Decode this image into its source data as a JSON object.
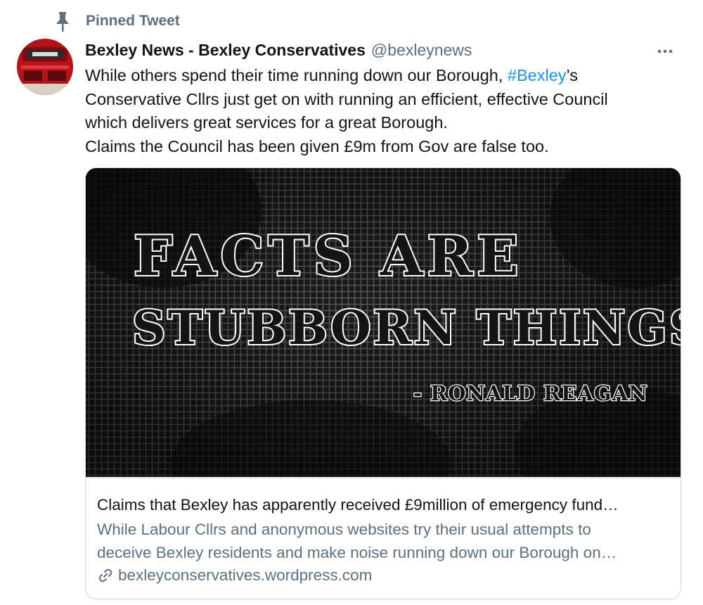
{
  "pinned": {
    "label": "Pinned Tweet",
    "icon": "pin-icon"
  },
  "author": {
    "name": "Bexley News - Bexley Conservatives",
    "handle": "@bexleynews",
    "avatar_icon": "red-bus-avatar"
  },
  "more_icon": "more-options-icon",
  "tweet": {
    "line1_pre": "While others spend their time running down our Borough, ",
    "hashtag": "#Bexley",
    "line1_post": "’s",
    "line2": "Conservative Cllrs just get on with running an efficient, effective Council",
    "line3": "which delivers great services for a great Borough.",
    "line4": "Claims the Council has been given £9m from Gov are false too."
  },
  "card": {
    "image": {
      "quote_line1": "FACTS ARE",
      "quote_line2": "STUBBORN THINGS.",
      "attribution": "- RONALD REAGAN"
    },
    "title": "Claims that Bexley has apparently received £9million of emergency fund…",
    "desc_line1": "While Labour Cllrs and anonymous websites try their usual attempts to",
    "desc_line2": "deceive Bexley residents and make noise running down our Borough on…",
    "domain": "bexleyconservatives.wordpress.com",
    "domain_icon": "link-icon"
  },
  "colors": {
    "secondary_text": "#5b7083",
    "link_blue": "#1b95e0",
    "border": "#cfd9de",
    "avatar_red": "#c4161c"
  }
}
